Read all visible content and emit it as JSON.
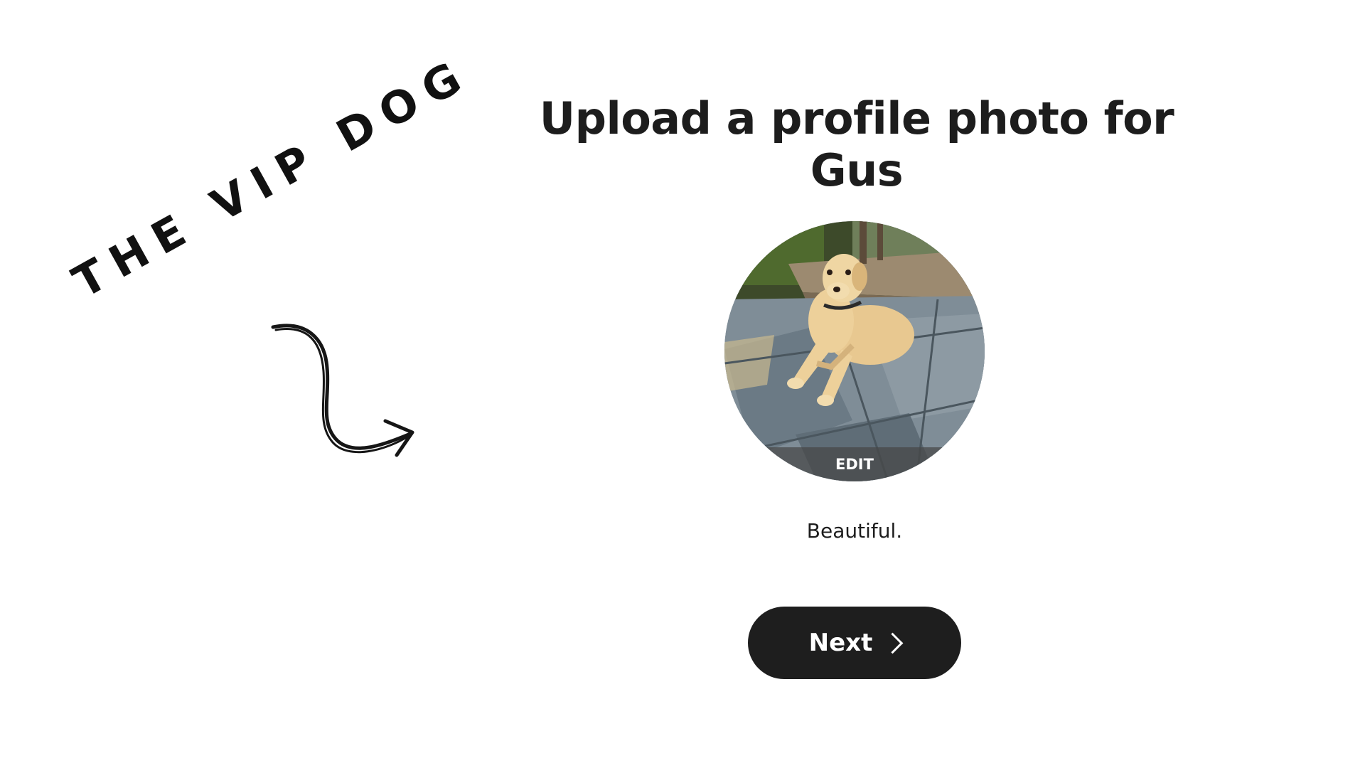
{
  "annotation": {
    "brand_text": "THE VIP DOG"
  },
  "main": {
    "title": "Upload a profile photo for Gus",
    "avatar_edit_label": "EDIT",
    "caption": "Beautiful.",
    "next_label": "Next"
  },
  "icons": {
    "arrow": "curved-arrow-icon",
    "next": "chevron-right-icon"
  },
  "colors": {
    "background": "#ffffff",
    "text": "#1d1d1d",
    "button": "#1e1e1e",
    "button_text": "#ffffff"
  }
}
